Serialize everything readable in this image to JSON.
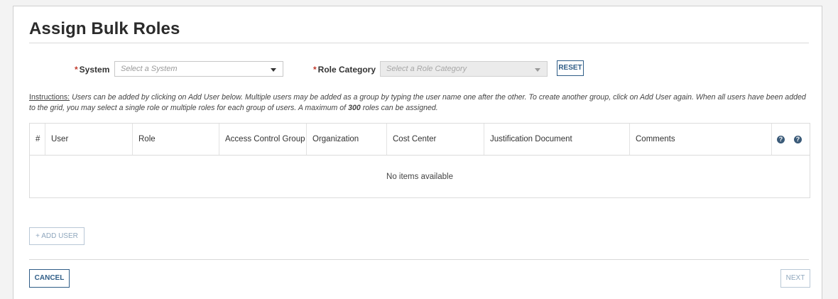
{
  "page": {
    "title": "Assign Bulk Roles"
  },
  "form": {
    "required_marker": "*",
    "system": {
      "label": "System",
      "placeholder": "Select a System"
    },
    "role_category": {
      "label": "Role Category",
      "placeholder": "Select a Role Category",
      "disabled": true
    },
    "reset_label": "RESET"
  },
  "instructions": {
    "heading": "Instructions:",
    "text_before": " Users can be added by clicking on Add User below. Multiple users may be added as a group by typing the user name one after the other. To create another group, click on Add User again. When all users have been added to the grid, you may select a single role or multiple roles for each group of users. A maximum of ",
    "max_roles": "300",
    "text_after": " roles can be assigned."
  },
  "grid": {
    "columns": [
      "#",
      "User",
      "Role",
      "Access Control Group",
      "Organization",
      "Cost Center",
      "Justification Document",
      "Comments"
    ],
    "help_icons": [
      "question-circle-icon",
      "question-circle-icon"
    ],
    "empty_message": "No items available"
  },
  "actions": {
    "add_user_label": "+ ADD USER",
    "cancel_label": "CANCEL",
    "next_label": "NEXT"
  },
  "colors": {
    "accent": "#2f5d87",
    "required": "#c0392b",
    "help_icon": "#3a5a78"
  }
}
